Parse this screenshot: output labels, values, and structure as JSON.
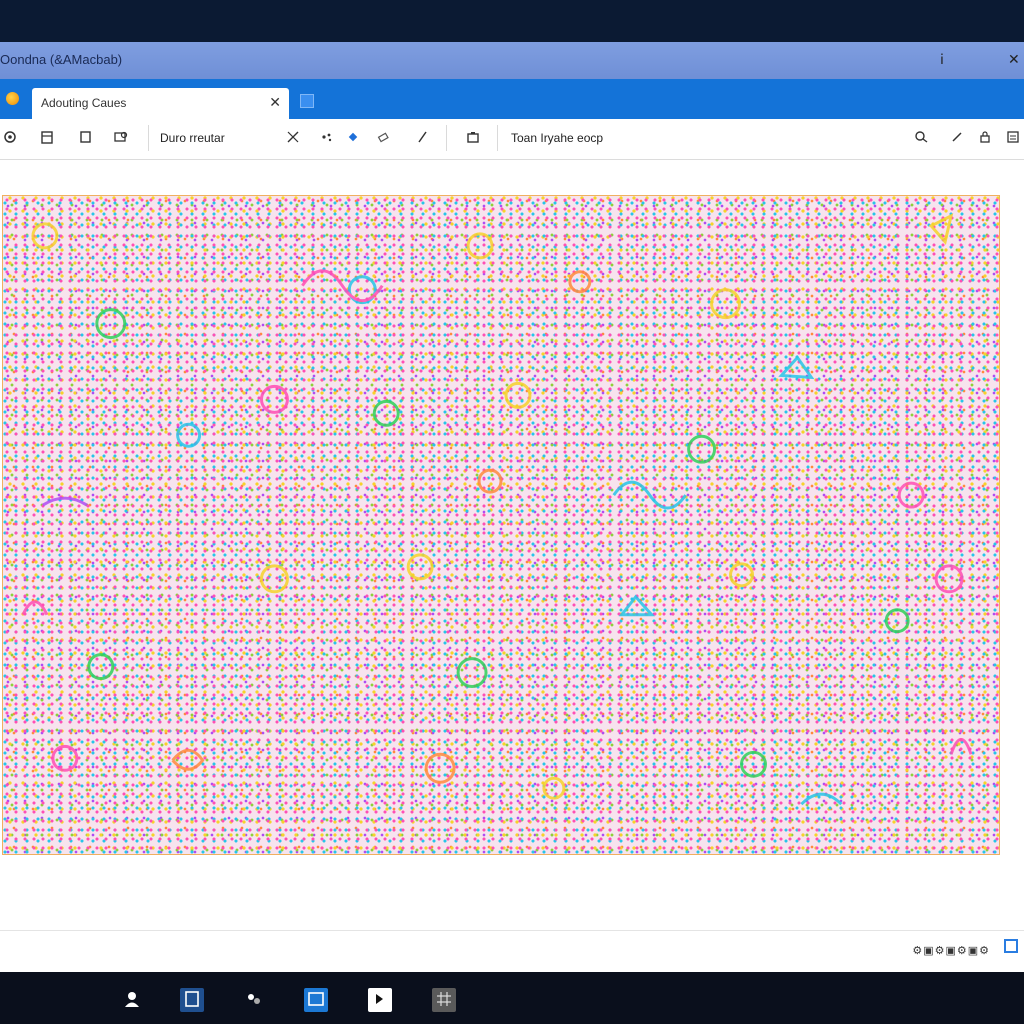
{
  "window": {
    "title": "Oondna (&AMacbab)",
    "minimize_glyph": "ⅰ",
    "close_glyph": "✕"
  },
  "tabs": [
    {
      "label": "Adouting Caues",
      "close_glyph": "✕"
    }
  ],
  "toolbar": {
    "left_icons": [
      "brush-settings-icon",
      "clipboard-icon",
      "copy-icon",
      "image-adjust-icon"
    ],
    "font_field": "Duro rreutar",
    "tool_icons": [
      "scissors-icon",
      "sparkle-icon",
      "fill-bucket-icon",
      "eraser-icon",
      "pen-icon"
    ],
    "camera_icon": "camera-icon",
    "text_field": "Toan Iryahe eocp",
    "right_icons": [
      "search-icon",
      "pencil-icon",
      "lock-icon",
      "menu-icon"
    ]
  },
  "statusbar": {
    "icons_text": "⚙▣⚙▣⚙▣⚙"
  },
  "taskbar": {
    "apps": [
      "user-icon",
      "window-icon",
      "paint-icon",
      "browser-icon",
      "terminal-icon",
      "grid-icon"
    ]
  },
  "colors": {
    "titlebar": "#7f9ee0",
    "tabbar": "#1473d8",
    "taskbar": "#0a0f1c",
    "artwork_palette": [
      "#ff4fb4",
      "#27c5e8",
      "#f6d22a",
      "#8fd13a",
      "#b04cf2",
      "#ff8a3d"
    ]
  }
}
